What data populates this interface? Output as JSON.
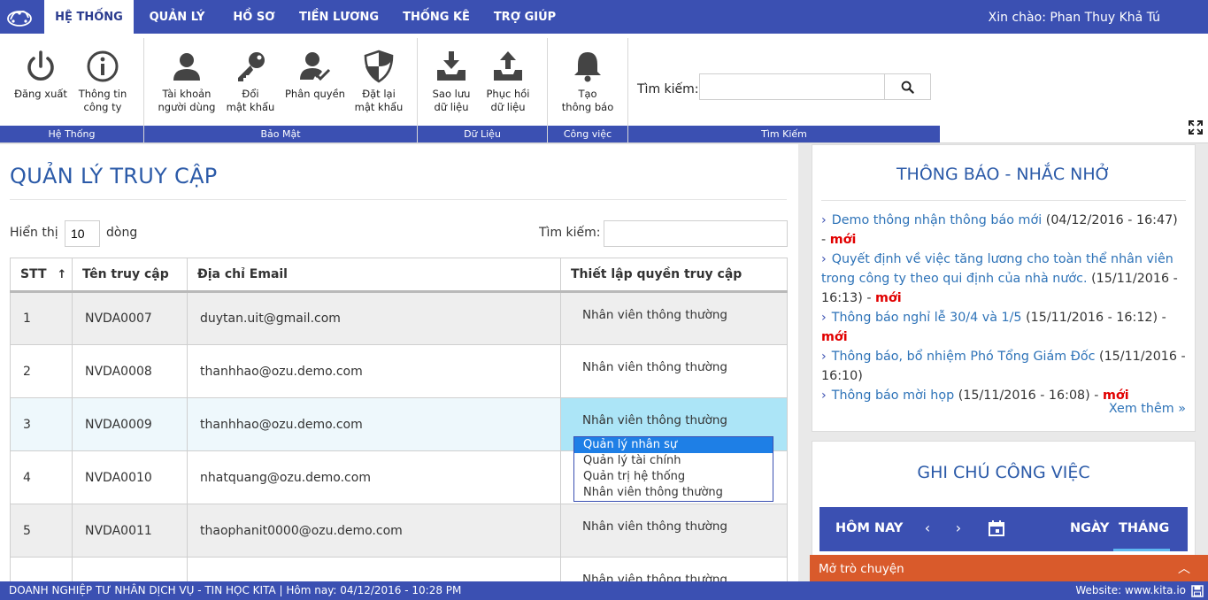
{
  "nav": {
    "tabs": [
      {
        "label": "HỆ THỐNG",
        "active": true
      },
      {
        "label": "QUẢN LÝ"
      },
      {
        "label": "HỒ SƠ"
      },
      {
        "label": "TIỀN LƯƠNG"
      },
      {
        "label": "THỐNG KÊ"
      },
      {
        "label": "TRỢ GIÚP"
      }
    ],
    "greeting": "Xin chào: Phan Thuy Khả Tú",
    "logo_icon": "cloud-logo-icon"
  },
  "ribbon": {
    "groups": [
      {
        "label": "Hệ Thống",
        "buttons": [
          {
            "label": "Đăng xuất",
            "icon": "power-icon"
          },
          {
            "label": "Thông tin\ncông ty",
            "icon": "info-icon"
          }
        ]
      },
      {
        "label": "Bảo Mật",
        "buttons": [
          {
            "label": "Tài khoản\nngười dùng",
            "icon": "user-icon"
          },
          {
            "label": "Đổi\nmật khẩu",
            "icon": "key-icon"
          },
          {
            "label": "Phân quyền",
            "icon": "user-check-icon"
          },
          {
            "label": "Đặt lại\nmật khẩu",
            "icon": "shield-icon"
          }
        ]
      },
      {
        "label": "Dữ Liệu",
        "buttons": [
          {
            "label": "Sao lưu\ndữ liệu",
            "icon": "download-tray-icon"
          },
          {
            "label": "Phục hồi\ndữ liệu",
            "icon": "upload-tray-icon"
          }
        ]
      },
      {
        "label": "Công việc",
        "buttons": [
          {
            "label": "Tạo\nthông báo",
            "icon": "bell-icon"
          }
        ]
      },
      {
        "label": "Tìm Kiếm"
      }
    ],
    "search_label": "Tìm kiếm:",
    "search_value": ""
  },
  "main": {
    "title": "QUẢN LÝ TRUY CẬP",
    "show_label": "Hiển thị",
    "show_value": "10",
    "show_suffix": "dòng",
    "search_label": "Tìm kiếm:",
    "columns": [
      "STT",
      "Tên truy cập",
      "Địa chỉ Email",
      "Thiết lập quyền truy cập"
    ],
    "rows": [
      {
        "stt": "1",
        "username": "NVDA0007",
        "email": "duytan.uit@gmail.com",
        "role": "Nhân viên thông thường"
      },
      {
        "stt": "2",
        "username": "NVDA0008",
        "email": "thanhhao@ozu.demo.com",
        "role": "Nhân viên thông thường"
      },
      {
        "stt": "3",
        "username": "NVDA0009",
        "email": "thanhhao@ozu.demo.com",
        "role": "Nhân viên thông thường"
      },
      {
        "stt": "4",
        "username": "NVDA0010",
        "email": "nhatquang@ozu.demo.com",
        "role": ""
      },
      {
        "stt": "5",
        "username": "NVDA0011",
        "email": "thaophanit0000@ozu.demo.com",
        "role": "Nhân viên thông thường"
      },
      {
        "stt": "",
        "username": "",
        "email": "",
        "role": "Nhân viên thông thường"
      }
    ],
    "role_options": [
      "Quản lý nhân sự",
      "Quản lý tài chính",
      "Quản trị hệ thống",
      "Nhân viên thông thường"
    ],
    "role_highlighted": "Quản lý nhân sự"
  },
  "notices": {
    "title": "THÔNG BÁO - NHẮC NHỞ",
    "items": [
      {
        "text": "Demo thông nhận thông báo mới",
        "date": "(04/12/2016 - 16:47) -",
        "badge": "mới"
      },
      {
        "text": "Quyết định về việc tăng lương cho toàn thể nhân viên trong công ty theo qui định của nhà nước.",
        "date": "(15/11/2016 - 16:13) -",
        "badge": "mới"
      },
      {
        "text": "Thông báo nghỉ lễ 30/4 và 1/5",
        "date": "(15/11/2016 - 16:12) -",
        "badge": "mới"
      },
      {
        "text": "Thông báo, bổ nhiệm Phó Tổng Giám Đốc",
        "date": "(15/11/2016 - 16:10)",
        "badge": ""
      },
      {
        "text": "Thông báo mời họp",
        "date": "(15/11/2016 - 16:08) -",
        "badge": "mới"
      }
    ],
    "see_more": "Xem thêm »"
  },
  "notes": {
    "title": "GHI CHÚ CÔNG VIỆC",
    "today": "HÔM NAY",
    "day": "NGÀY",
    "month": "THÁNG"
  },
  "chat": {
    "label": "Mở trò chuyện"
  },
  "footer": {
    "left": "DOANH NGHIỆP TƯ NHÂN DỊCH VỤ - TIN HỌC KITA | Hôm nay: 04/12/2016 - 10:28 PM",
    "right": "Website: www.kita.io"
  },
  "colors": {
    "primary": "#3b50b2",
    "title": "#2b5aa8",
    "link": "#2e73b8",
    "badge": "#e10000",
    "chat": "#d95a2b",
    "dropdown_highlight": "#1e7fe6"
  }
}
